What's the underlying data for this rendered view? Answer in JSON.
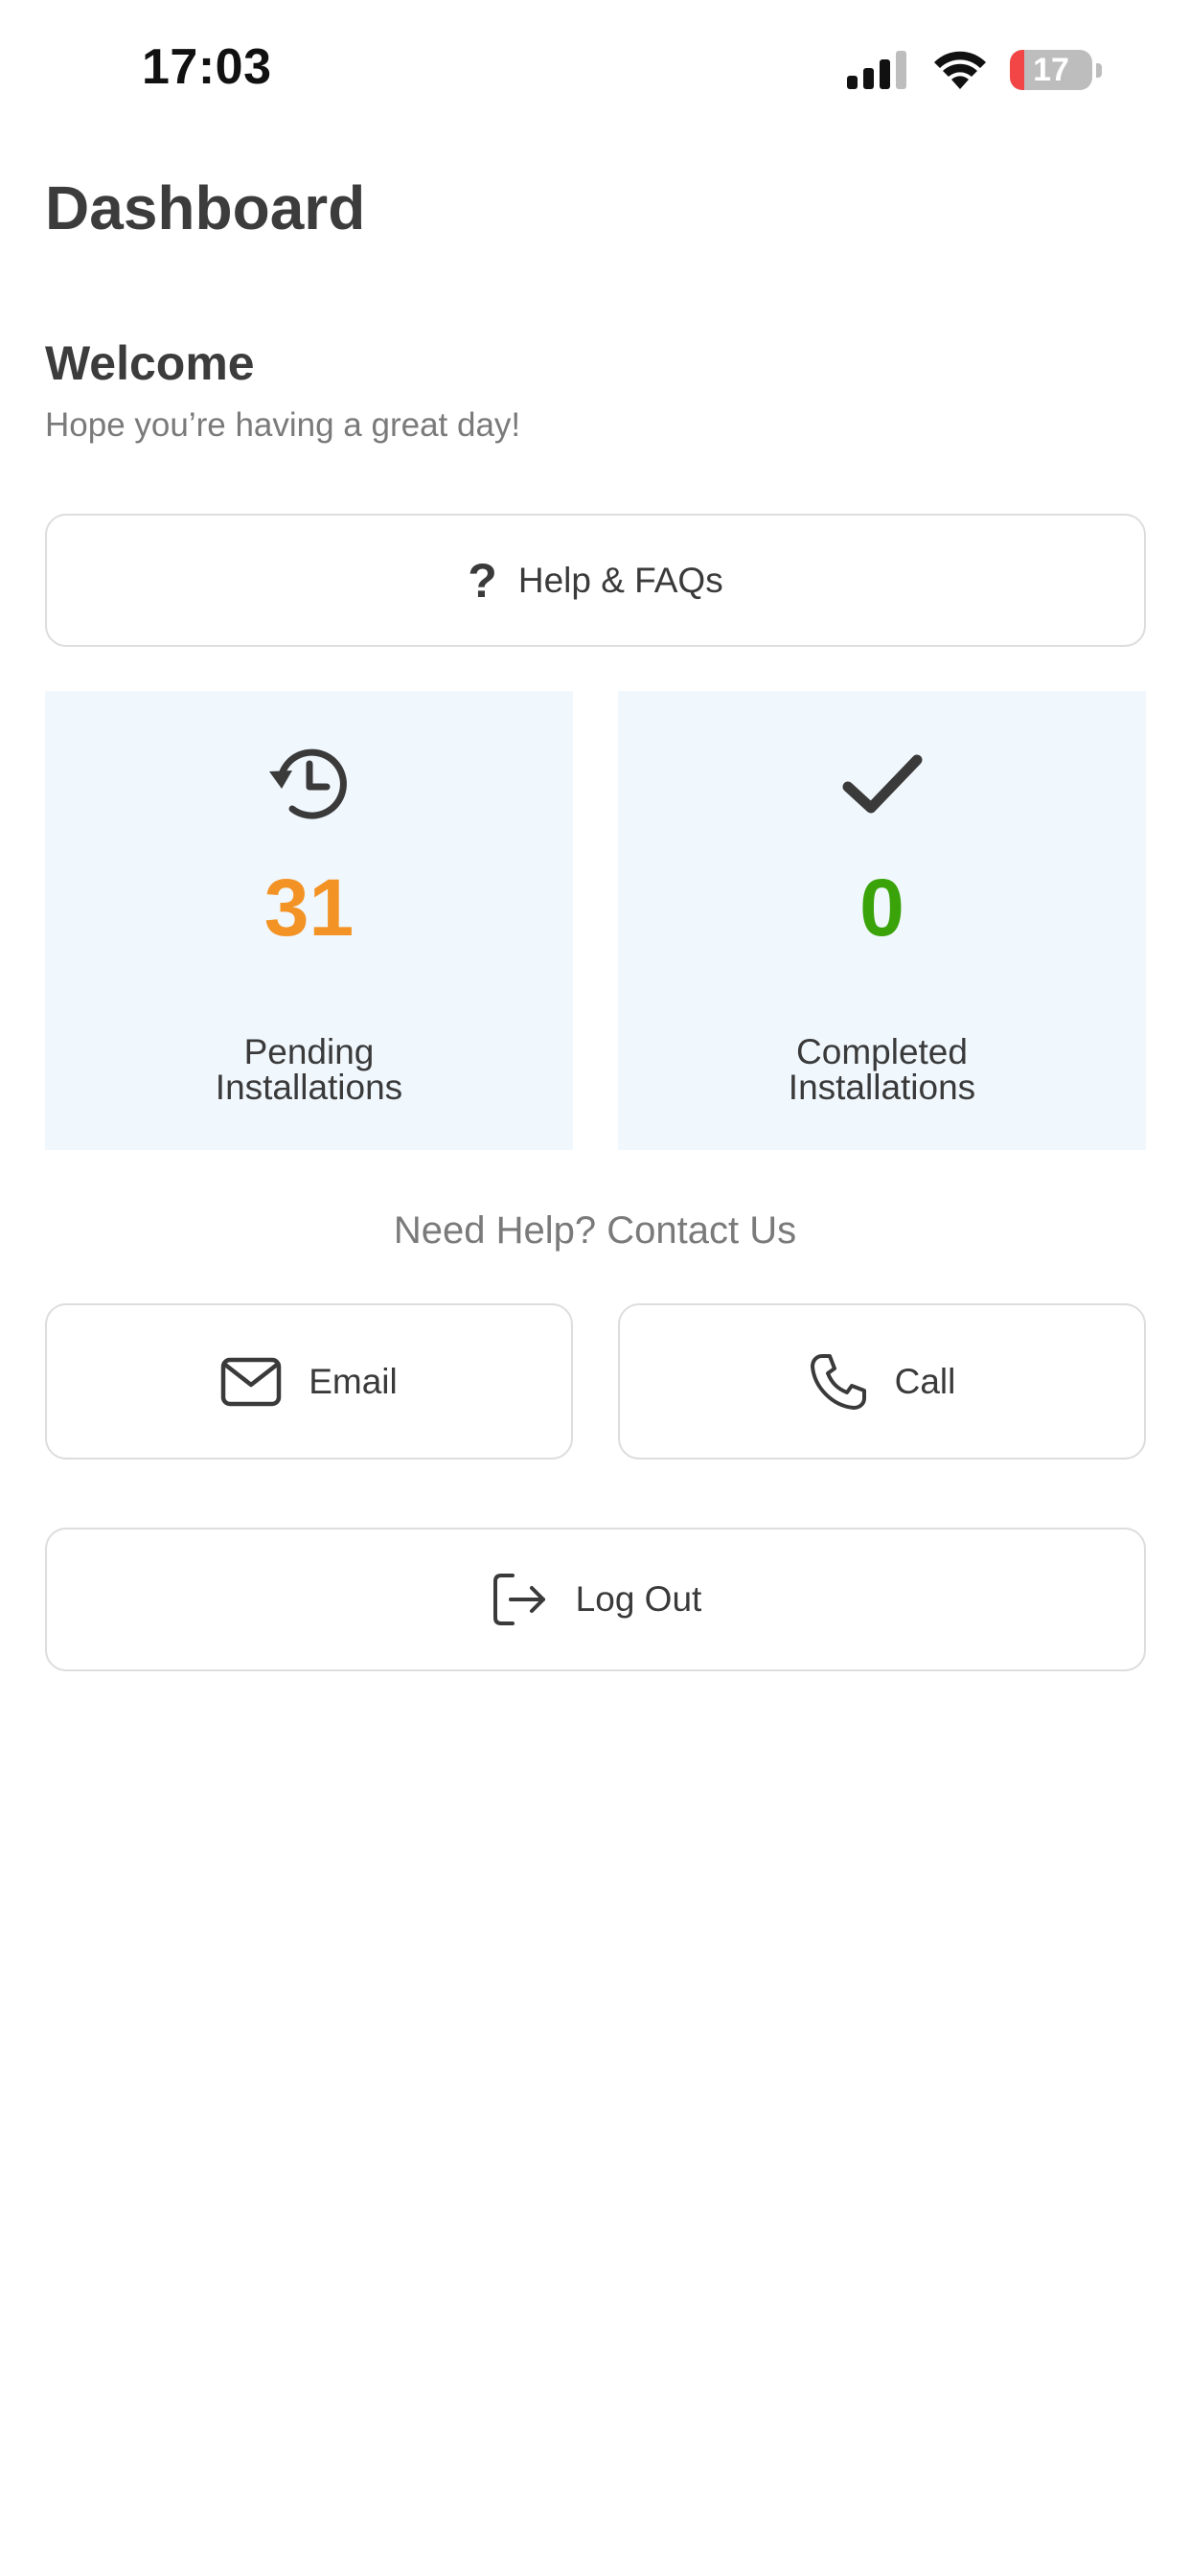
{
  "status_bar": {
    "time": "17:03",
    "battery_level": "17",
    "battery_fraction": 0.17,
    "battery_color": "#f24545"
  },
  "header": {
    "title": "Dashboard"
  },
  "welcome": {
    "title": "Welcome",
    "subtitle": "Hope you’re having a great day!"
  },
  "help_button": {
    "label": "Help & FAQs",
    "icon": "question-mark-icon"
  },
  "stats": {
    "pending": {
      "value": "31",
      "label_line1": "Pending",
      "label_line2": "Installations",
      "color": "#f39325",
      "icon": "clock-history-icon"
    },
    "completed": {
      "value": "0",
      "label_line1": "Completed",
      "label_line2": "Installations",
      "color": "#3aa30a",
      "icon": "checkmark-icon"
    }
  },
  "contact": {
    "heading": "Need Help? Contact Us",
    "email_label": "Email",
    "call_label": "Call"
  },
  "logout": {
    "label": "Log Out"
  },
  "colors": {
    "card_background": "#f0f7fd",
    "border": "#dddddd",
    "text_dark": "#3a3a3a",
    "text_muted": "#7a7a7a"
  }
}
